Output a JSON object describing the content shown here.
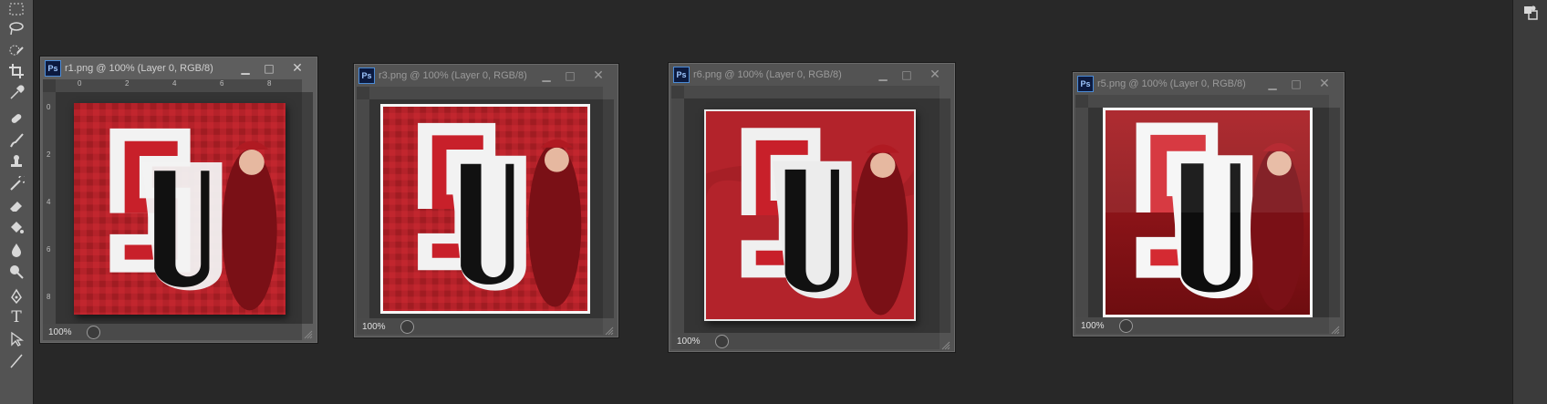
{
  "toolbar": {
    "tools": [
      {
        "name": "marquee-tool-icon"
      },
      {
        "name": "lasso-tool-icon"
      },
      {
        "name": "quick-selection-tool-icon"
      },
      {
        "name": "crop-tool-icon"
      },
      {
        "name": "eyedropper-tool-icon"
      },
      {
        "name": "healing-brush-tool-icon"
      },
      {
        "name": "brush-tool-icon"
      },
      {
        "name": "clone-stamp-tool-icon"
      },
      {
        "name": "history-brush-tool-icon"
      },
      {
        "name": "eraser-tool-icon"
      },
      {
        "name": "paint-bucket-tool-icon"
      },
      {
        "name": "blur-tool-icon"
      },
      {
        "name": "dodge-tool-icon"
      },
      {
        "name": "pen-tool-icon"
      },
      {
        "name": "type-tool-icon",
        "glyph": "T"
      },
      {
        "name": "path-selection-tool-icon"
      },
      {
        "name": "line-tool-icon"
      }
    ]
  },
  "right_panel": {
    "icon": "panel-icon"
  },
  "windows": [
    {
      "title": "r1.png @ 100% (Layer 0, RGB/8)",
      "zoom": "100%",
      "ruler_top": [
        "0",
        "2",
        "4",
        "6",
        "8"
      ],
      "ruler_left": [
        "0",
        "2",
        "4",
        "6",
        "8"
      ],
      "variant": "embossed"
    },
    {
      "title": "r3.png @ 100% (Layer 0, RGB/8)",
      "zoom": "100%",
      "variant": "white-border"
    },
    {
      "title": "r6.png @ 100% (Layer 0, RGB/8)",
      "zoom": "100%",
      "variant": "textured"
    },
    {
      "title": "r5.png @ 100% (Layer 0, RGB/8)",
      "zoom": "100%",
      "variant": "glossy"
    }
  ],
  "colors": {
    "accent_red": "#c8202a",
    "dark_red": "#8e1418",
    "white": "#f4f4f4",
    "black": "#111111"
  }
}
